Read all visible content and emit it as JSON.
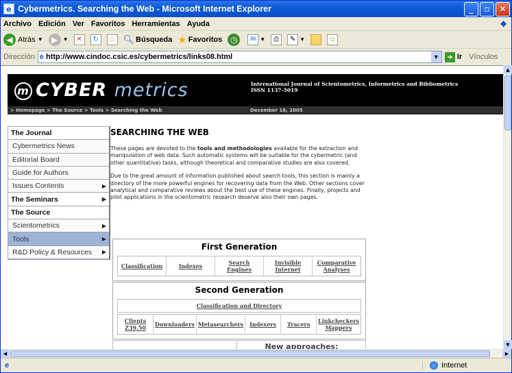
{
  "window": {
    "title": "Cybermetrics. Searching the Web - Microsoft Internet Explorer"
  },
  "menubar": [
    "Archivo",
    "Edición",
    "Ver",
    "Favoritos",
    "Herramientas",
    "Ayuda"
  ],
  "toolbar": {
    "back": "Atrás",
    "search": "Búsqueda",
    "favorites": "Favoritos"
  },
  "address": {
    "label": "Dirección",
    "url": "http://www.cindoc.csic.es/cybermetrics/links08.html",
    "go": "Ir",
    "links": "Vínculos"
  },
  "banner": {
    "logo_cyber": "CYBER",
    "logo_metrics": "metrics",
    "logo_mark": "m",
    "journal_line1": "International Journal of Scientometrics, Informetrics and Bibliometrics",
    "journal_line2": "ISSN 1137-5019",
    "breadcrumb": "> Homepage > The Source > Tools > Searching the Web",
    "date": "December 16, 2005"
  },
  "leftnav": [
    {
      "label": "The Journal",
      "type": "section",
      "arrow": ""
    },
    {
      "label": "Cybermetrics News",
      "type": "item",
      "arrow": ""
    },
    {
      "label": "Editorial Board",
      "type": "item",
      "arrow": ""
    },
    {
      "label": "Guide for Authors",
      "type": "item",
      "arrow": ""
    },
    {
      "label": "Issues Contents",
      "type": "item",
      "arrow": "▶"
    },
    {
      "label": "The Seminars",
      "type": "section",
      "arrow": "▶"
    },
    {
      "label": "The Source",
      "type": "section",
      "arrow": ""
    },
    {
      "label": "Scientometrics",
      "type": "item",
      "arrow": "▶"
    },
    {
      "label": "Tools",
      "type": "active",
      "arrow": "▶"
    },
    {
      "label": "R&D Policy & Resources",
      "type": "item",
      "arrow": "▶"
    }
  ],
  "main": {
    "heading": "SEARCHING THE WEB",
    "p1_a": "These pages are devoted to the ",
    "p1_bold": "tools and methodologies",
    "p1_b": " available for the extraction and manipulation of web data. Such automatic systems will be suitable for the cybermetric (and other quantitative) tasks, although theoretical and comparative studies are also covered.",
    "p2": "Due to the great amount of information published about search tools, this section is mainly a directory of the more powerful engines for recovering data from the Web. Other sections cover analytical and comparative reviews about the best use of these engines. Finally, projects and pilot applications in the scientometric research deserve also their own pages."
  },
  "first_gen": {
    "title": "First Generation",
    "cells": [
      "Classification",
      "Indexes",
      "Search Engines",
      "Invisible Internet",
      "Comparative Analyses"
    ]
  },
  "second_gen": {
    "title": "Second Generation",
    "subhead": "Classification and Directory",
    "cells": [
      "Clients Z39.50",
      "Downloaders",
      "Metasearchers",
      "Indexers",
      "Tracers",
      "Linkcheckers Mappers"
    ]
  },
  "new_approaches": "New approaches:",
  "status": {
    "zone": "Internet"
  }
}
